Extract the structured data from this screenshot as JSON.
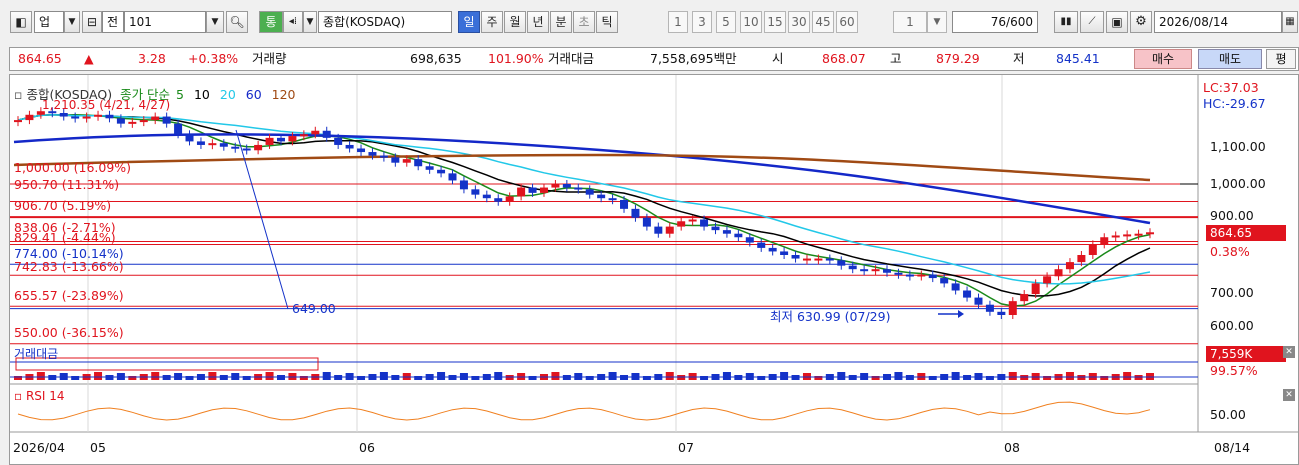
{
  "toolbar": {
    "market": "업",
    "jeon": "전",
    "code": "101",
    "tong": "통",
    "name": "종합(KOSDAQ)",
    "periods": [
      {
        "label": "일",
        "active": true
      },
      {
        "label": "주",
        "active": false
      },
      {
        "label": "월",
        "active": false
      },
      {
        "label": "년",
        "active": false
      },
      {
        "label": "분",
        "active": false
      },
      {
        "label": "초",
        "active": false
      },
      {
        "label": "틱",
        "active": false
      }
    ],
    "numbers": [
      "1",
      "3",
      "5",
      "10",
      "15",
      "30",
      "45",
      "60"
    ],
    "count_value": "1",
    "display_count": "76",
    "total_count": "/600",
    "date": "2026/08/14"
  },
  "quote": {
    "price": "864.65",
    "arrow": "▲",
    "change": "3.28",
    "change_pct": "+0.38%",
    "volume_label": "거래량",
    "volume": "698,635",
    "volume_ratio": "101.90%",
    "amount_label": "거래대금",
    "amount": "7,558,695백만",
    "open_label": "시",
    "open": "868.07",
    "high_label": "고",
    "high": "879.29",
    "low_label": "저",
    "low": "845.41",
    "buy_label": "매수",
    "sell_label": "매도",
    "avg_label": "평"
  },
  "chart": {
    "legend_title": "종합(KOSDAQ)",
    "legend_type": "종가 단순",
    "ma": [
      {
        "period": "5",
        "color": "#1a8a1a"
      },
      {
        "period": "10",
        "color": "#000000"
      },
      {
        "period": "20",
        "color": "#22c8e8"
      },
      {
        "period": "60",
        "color": "#1428c8"
      },
      {
        "period": "120",
        "color": "#a04a14"
      }
    ],
    "top_annot": "1,210.35 (4/21, 4/27)",
    "lc": "LC:37.03",
    "hc": "HC:-29.67",
    "levels": [
      {
        "label": "1,000.00 (16.09%)",
        "value": 1000
      },
      {
        "label": "950.70 (11.31%)",
        "value": 950.7
      },
      {
        "label": "906.70 (5.19%)",
        "value": 906.7
      },
      {
        "label": "838.06 (-2.71%)",
        "value": 838.06
      },
      {
        "label": "829.41 (-4.44%)",
        "value": 829.41
      },
      {
        "label": "774.00 (-10.14%)",
        "value": 774
      },
      {
        "label": "742.83 (-13.66%)",
        "value": 742.83
      },
      {
        "label": "655.57 (-23.89%)",
        "value": 655.57
      },
      {
        "label": "550.00 (-36.15%)",
        "value": 550
      }
    ],
    "line_label": "649.00",
    "low_annot": "최저 630.99 (07/29)",
    "y_ticks": [
      "1,100.00",
      "1,000.00",
      "900.00",
      "700.00",
      "600.00"
    ],
    "current_badge": "864.65",
    "current_pct": "0.38%",
    "volume_label": "거래대금",
    "volume_badge": "7,559K",
    "volume_pct": "99.57%",
    "rsi_label": "RSI 14",
    "rsi_tick": "50.00",
    "x_labels": [
      "2026/04",
      "05",
      "06",
      "07",
      "08"
    ],
    "x_end": "08/14",
    "colors": {
      "up": "#e0141e",
      "down": "#1432c8",
      "level": "#e0141e"
    }
  }
}
